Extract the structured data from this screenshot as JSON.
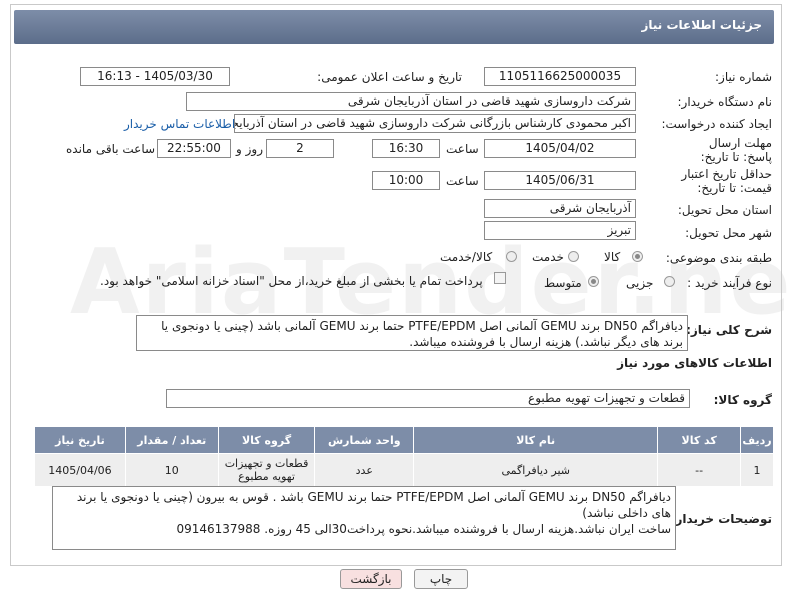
{
  "header": {
    "title": "جزئیات اطلاعات نیاز"
  },
  "fields": {
    "need_number_label": "شماره نیاز:",
    "need_number": "1105116625000035",
    "announce_label": "تاریخ و ساعت اعلان عمومی:",
    "announce_value": "1405/03/30 - 16:13",
    "buyer_org_label": "نام دستگاه خریدار:",
    "buyer_org": "شرکت داروسازی شهید قاضی در استان آذربایجان شرقی",
    "requester_label": "ایجاد کننده درخواست:",
    "requester": "اکبر محمودی  کارشناس بازرگانی شرکت داروسازی شهید قاضی در استان آذربایجان شرقی",
    "contact_link": "اطلاعات تماس خریدار",
    "deadline_label": "مهلت ارسال پاسخ: تا تاریخ:",
    "deadline_date": "1405/04/02",
    "time_label": "ساعت",
    "deadline_time": "16:30",
    "days": "2",
    "days_label": "روز و",
    "remaining_time": "22:55:00",
    "remaining_label": "ساعت باقی مانده",
    "min_price_label": "حداقل تاریخ اعتبار قیمت: تا تاریخ:",
    "min_price_date": "1405/06/31",
    "min_price_time": "10:00",
    "province_label": "استان محل تحویل:",
    "province": "آذربایجان شرقی",
    "city_label": "شهر محل تحویل:",
    "city": "تبریز",
    "category_label": "طبقه بندی موضوعی:",
    "category_options": [
      "کالا",
      "خدمت",
      "کالا/خدمت"
    ],
    "process_label": "نوع فرآیند خرید :",
    "process_options": [
      "جزیی",
      "متوسط"
    ],
    "payment_note": "پرداخت تمام یا بخشی از مبلغ خرید،از محل \"اسناد خزانه اسلامی\" خواهد بود."
  },
  "summary": {
    "label": "شرح کلی نیاز:",
    "text": "دیافراگم DN50  برند GEMU آلمانی اصل PTFE/EPDM   حتما برند GEMU آلمانی  باشد   (چینی یا دونجوی یا برند های دیگر نباشد.) هزینه ارسال با فروشنده میباشد."
  },
  "goods": {
    "section_title": "اطلاعات کالاهای مورد نیاز",
    "group_label": "گروه کالا:",
    "group_value": "قطعات و تجهیزات تهویه مطبوع",
    "columns": [
      "ردیف",
      "کد کالا",
      "نام کالا",
      "واحد شمارش",
      "گروه کالا",
      "تعداد / مقدار",
      "تاریخ نیاز"
    ],
    "rows": [
      {
        "row": "1",
        "code": "--",
        "name": "شیر دیافراگمی",
        "unit": "عدد",
        "group": "قطعات و تجهیزات تهویه مطبوع",
        "qty": "10",
        "date": "1405/04/06"
      }
    ]
  },
  "buyer_notes": {
    "label": "توضیحات خریدار:",
    "line1": "دیافراگم DN50 برند GEMU آلمانی اصل PTFE/EPDM   حتما برند GEMU باشد . قوس به بیرون (چینی یا دونجوی یا برند های داخلی نباشد)",
    "line2": "ساخت ایران نباشد.هزینه ارسال با فروشنده میباشد.نحوه پرداخت30الی 45 روزه.     09146137988"
  },
  "buttons": {
    "print": "چاپ",
    "back": "بازگشت"
  }
}
